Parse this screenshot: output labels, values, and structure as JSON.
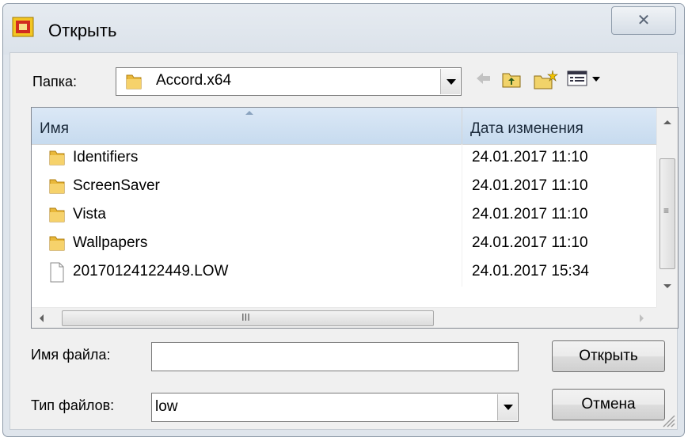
{
  "window": {
    "title": "Открыть",
    "close_glyph": "✕"
  },
  "lookin": {
    "label": "Папка:",
    "value": "Accord.x64"
  },
  "toolbar": {
    "icons": [
      "back-arrow-icon",
      "up-folder-icon",
      "new-folder-icon",
      "view-menu-icon"
    ]
  },
  "list": {
    "columns": {
      "name": "Имя",
      "date": "Дата изменения"
    },
    "rows": [
      {
        "name": "Identifiers",
        "date": "24.01.2017 11:10",
        "type": "folder"
      },
      {
        "name": "ScreenSaver",
        "date": "24.01.2017 11:10",
        "type": "folder"
      },
      {
        "name": "Vista",
        "date": "24.01.2017 11:10",
        "type": "folder"
      },
      {
        "name": "Wallpapers",
        "date": "24.01.2017 11:10",
        "type": "folder"
      },
      {
        "name": "20170124122449.LOW",
        "date": "24.01.2017 15:34",
        "type": "file"
      }
    ]
  },
  "filename": {
    "label": "Имя файла:",
    "value": ""
  },
  "filetype": {
    "label": "Тип файлов:",
    "value": "low"
  },
  "buttons": {
    "open": "Открыть",
    "cancel": "Отмена"
  },
  "colors": {
    "header_bg": "#d4e3f3",
    "window_frame": "#dfe5ec",
    "client_bg": "#f0f0f0"
  }
}
